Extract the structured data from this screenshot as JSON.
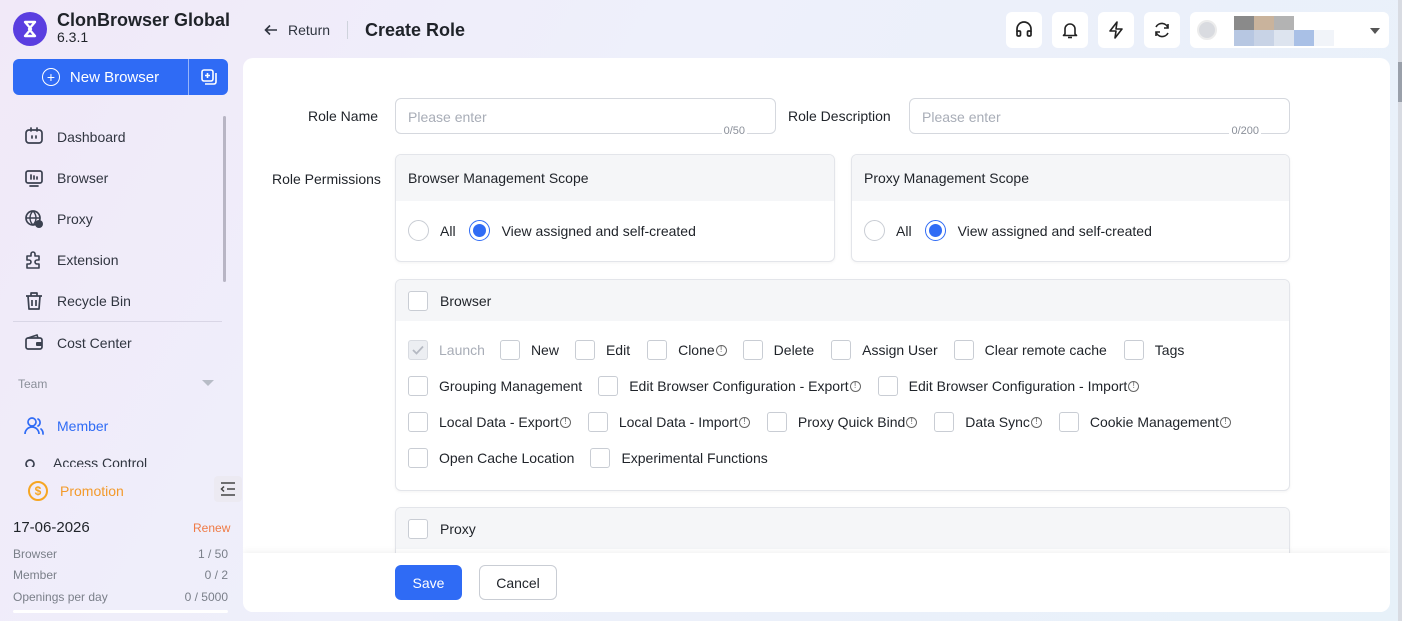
{
  "app": {
    "name": "ClonBrowser Global",
    "version": "6.3.1"
  },
  "sidebar": {
    "new_browser_label": "New Browser",
    "items": [
      {
        "label": "Dashboard",
        "icon": "dashboard-icon"
      },
      {
        "label": "Browser",
        "icon": "browser-icon"
      },
      {
        "label": "Proxy",
        "icon": "proxy-icon"
      },
      {
        "label": "Extension",
        "icon": "extension-icon"
      },
      {
        "label": "Recycle Bin",
        "icon": "recycle-bin-icon"
      },
      {
        "label": "Cost Center",
        "icon": "wallet-icon"
      }
    ],
    "team_label": "Team",
    "member_label": "Member",
    "access_control_label": "Access Control",
    "promotion_label": "Promotion",
    "promotion_icon_glyph": "$",
    "expiry_date": "17-06-2026",
    "renew_label": "Renew",
    "stats": [
      {
        "label": "Browser",
        "value": "1 / 50"
      },
      {
        "label": "Member",
        "value": "0 / 2"
      },
      {
        "label": "Openings per day",
        "value": "0 / 5000"
      }
    ]
  },
  "header": {
    "return_label": "Return",
    "title": "Create Role",
    "icons": [
      "headset-icon",
      "bell-icon",
      "lightning-icon",
      "sync-icon"
    ]
  },
  "form": {
    "role_name_label": "Role Name",
    "role_name_placeholder": "Please enter",
    "role_name_count": "0/50",
    "role_desc_label": "Role Description",
    "role_desc_placeholder": "Please enter",
    "role_desc_count": "0/200",
    "permissions_label": "Role Permissions",
    "browser_scope": {
      "title": "Browser Management Scope",
      "options": [
        "All",
        "View assigned and self-created"
      ],
      "selected": "View assigned and self-created"
    },
    "proxy_scope": {
      "title": "Proxy Management Scope",
      "options": [
        "All",
        "View assigned and self-created"
      ],
      "selected": "View assigned and self-created"
    },
    "browser_group": {
      "title": "Browser",
      "rows": [
        [
          "Launch",
          "New",
          "Edit",
          "Clone",
          "Delete",
          "Assign User",
          "Clear remote cache",
          "Tags"
        ],
        [
          "Grouping Management",
          "Edit Browser Configuration - Export",
          "Edit Browser Configuration - Import"
        ],
        [
          "Local Data - Export",
          "Local Data - Import",
          "Proxy Quick Bind",
          "Data Sync",
          "Cookie Management"
        ],
        [
          "Open Cache Location",
          "Experimental Functions"
        ]
      ]
    },
    "proxy_group": {
      "title": "Proxy"
    },
    "info_glyph": "!",
    "save_label": "Save",
    "cancel_label": "Cancel"
  },
  "colors": {
    "accent": "#2f6bf5",
    "brand": "#5a3ee0",
    "promotion": "#f39a2b",
    "renew": "#ef7a45"
  }
}
